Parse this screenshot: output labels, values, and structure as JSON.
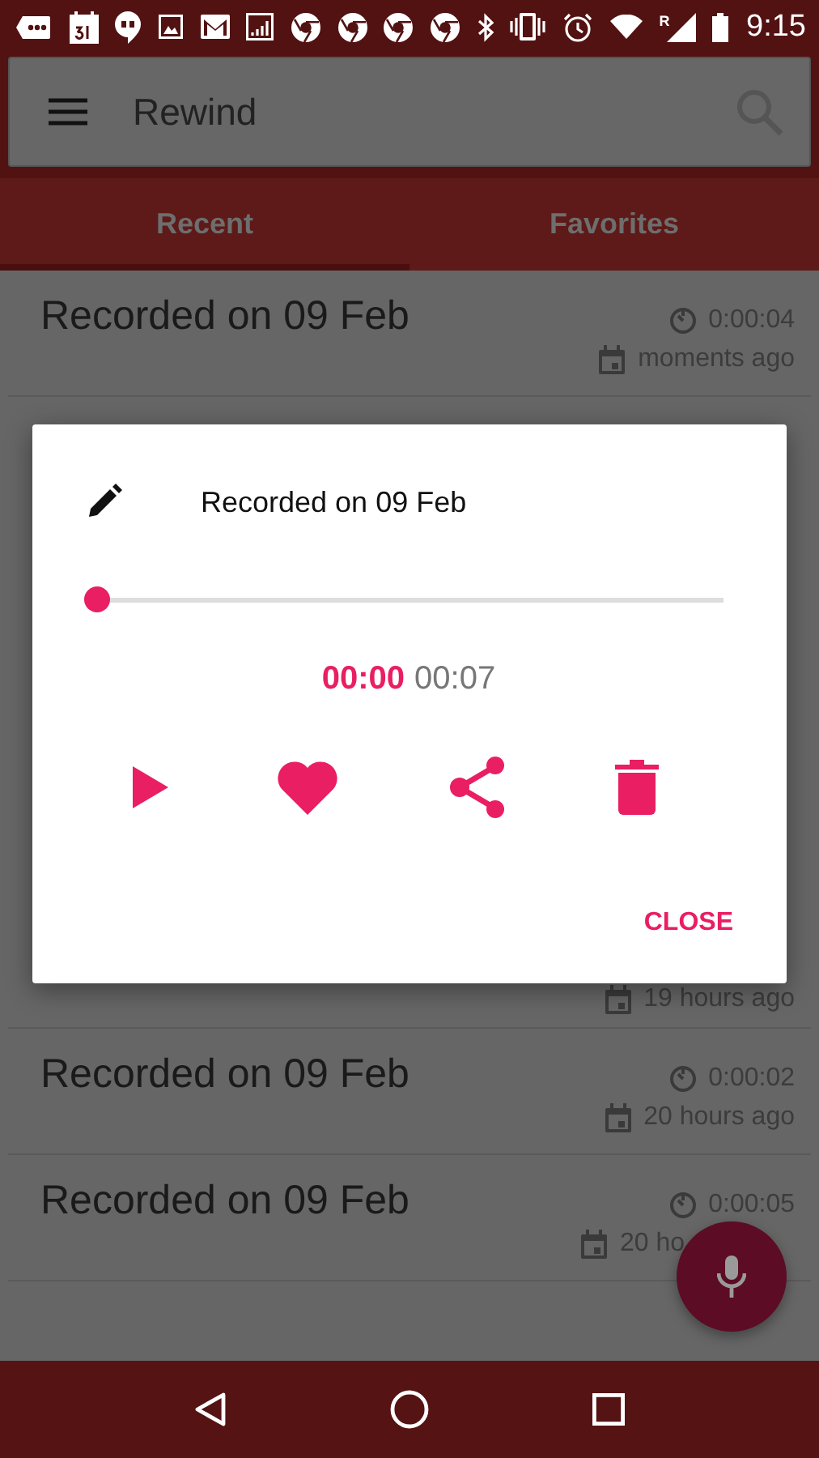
{
  "status_bar": {
    "roaming_label": "R",
    "time": "9:15"
  },
  "app_bar": {
    "title": "Rewind"
  },
  "tabs": [
    {
      "label": "Recent",
      "selected": true
    },
    {
      "label": "Favorites",
      "selected": false
    }
  ],
  "recordings": [
    {
      "kind": "full",
      "title": "Recorded on 09 Feb",
      "duration": "0:00:04",
      "when": "moments ago"
    },
    {
      "kind": "partial",
      "when": "19 hours ago"
    },
    {
      "kind": "full",
      "title": "Recorded on 09 Feb",
      "duration": "0:00:02",
      "when": "20 hours ago"
    },
    {
      "kind": "clipped",
      "title": "Recorded on 09 Feb",
      "duration": "0:00:05",
      "when": "20 ho"
    }
  ],
  "dialog": {
    "title": "Recorded on 09 Feb",
    "level": 0,
    "elapsed": "00:00",
    "total": "00:07",
    "close_label": "CLOSE"
  }
}
